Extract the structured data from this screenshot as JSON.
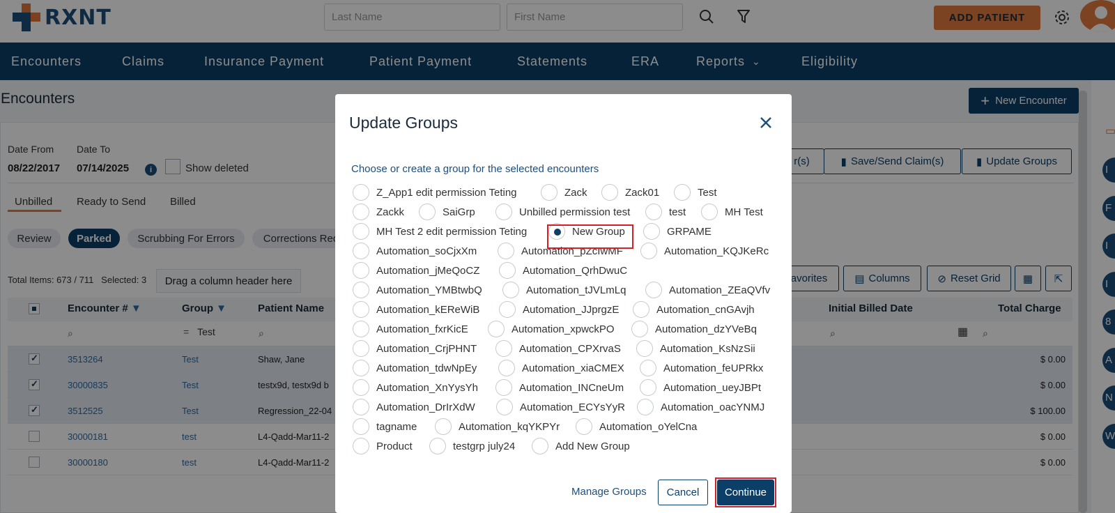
{
  "header": {
    "brand": "RXNT",
    "last_name_placeholder": "Last Name",
    "first_name_placeholder": "First Name",
    "add_patient_label": "ADD PATIENT"
  },
  "nav": {
    "items": [
      "Encounters",
      "Claims",
      "Insurance Payment",
      "Patient Payment",
      "Statements",
      "ERA",
      "Reports",
      "Eligibility"
    ]
  },
  "page": {
    "title": "Encounters",
    "new_encounter_label": "New Encounter",
    "date_from_label": "Date From",
    "date_from_value": "08/22/2017",
    "date_to_label": "Date To",
    "date_to_value": "07/14/2025",
    "show_deleted_label": "Show deleted",
    "tabs": [
      "Unbilled",
      "Ready to Send",
      "Billed"
    ],
    "chips": [
      "Review",
      "Parked",
      "Scrubbing For Errors",
      "Corrections Req"
    ],
    "action_buttons": [
      "r(s)",
      "Save/Send Claim(s)",
      "Update Groups"
    ],
    "total_items": "Total Items: 673 / 711   Selected: 3",
    "drag_hint": "Drag a column header here",
    "grid_buttons": [
      "avorites",
      "Columns",
      "Reset Grid"
    ],
    "columns": [
      "Encounter #",
      "Group",
      "Patient Name",
      "Initial Billed Date",
      "Total Charge"
    ],
    "group_filter_value": "Test",
    "rows": [
      {
        "encounter": "3513264",
        "group": "Test",
        "patient": "Shaw, Jane",
        "charge": "$ 0.00",
        "checked": true
      },
      {
        "encounter": "30000835",
        "group": "Test",
        "patient": "testx9d, testx9d b",
        "charge": "$ 0.00",
        "checked": true
      },
      {
        "encounter": "3512525",
        "group": "Test",
        "patient": "Regression_22-04",
        "charge": "$ 100.00",
        "checked": true
      },
      {
        "encounter": "30000181",
        "group": "test",
        "patient": "L4-Qadd-Mar11-2",
        "charge": "$ 0.00",
        "checked": false
      },
      {
        "encounter": "30000180",
        "group": "test",
        "patient": "L4-Qadd-Mar11-2",
        "charge": "$ 0.00",
        "checked": false
      }
    ],
    "side_letters": [
      "I",
      "F",
      "I",
      "I",
      "8",
      "A",
      "N",
      "W"
    ]
  },
  "modal": {
    "title": "Update Groups",
    "subtitle": "Choose or create a group for the selected encounters",
    "selected_option": "New Group",
    "options": [
      "Z_App1 edit permission Teting",
      "Zack",
      "Zack01",
      "Test",
      "Zackk",
      "SaiGrp",
      "Unbilled permission test",
      "test",
      "MH Test",
      "MH Test 2 edit permission Teting",
      "New Group",
      "GRPAME",
      "Automation_soCjxXm",
      "Automation_pZcIwMF",
      "Automation_KQJKeRc",
      "Automation_jMeQoCZ",
      "Automation_QrhDwuC",
      "Automation_YMBtwbQ",
      "Automation_tJVLmLq",
      "Automation_ZEaQVfv",
      "Automation_kEReWiB",
      "Automation_JJprgzE",
      "Automation_cnGAvjh",
      "Automation_fxrKicE",
      "Automation_xpwckPO",
      "Automation_dzYVeBq",
      "Automation_CrjPHNT",
      "Automation_CPXrvaS",
      "Automation_KsNzSii",
      "Automation_tdwNpEy",
      "Automation_xiaCMEX",
      "Automation_feUPRkx",
      "Automation_XnYysYh",
      "Automation_INCneUm",
      "Automation_ueyJBPt",
      "Automation_DrIrXdW",
      "Automation_ECYsYyR",
      "Automation_oacYNMJ",
      "tagname",
      "Automation_kqYKPYr",
      "Automation_oYelCna",
      "Product",
      "testgrp july24",
      "Add New Group"
    ],
    "manage_groups_label": "Manage Groups",
    "cancel_label": "Cancel",
    "continue_label": "Continue"
  }
}
